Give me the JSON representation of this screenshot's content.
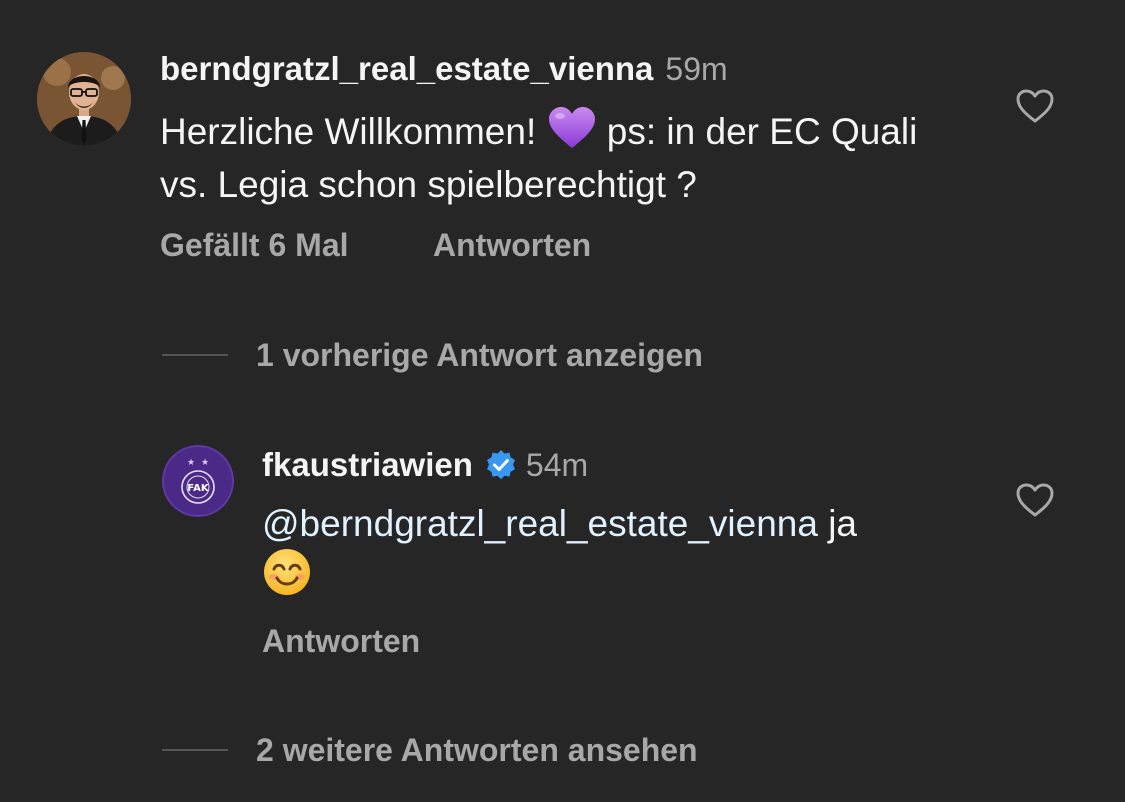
{
  "comment_1": {
    "username": "berndgratzl_real_estate_vienna",
    "time": "59m",
    "text_before_emoji": "Herzliche Willkommen! ",
    "emoji": "purple-heart",
    "text_after_emoji": " ps: in der EC Quali vs. Legia schon spielberechtigt ?",
    "likes_label": "Gefällt 6 Mal",
    "reply_label": "Antworten",
    "avatar": "user-avatar-photo"
  },
  "view_previous_label": "1 vorherige Antwort anzeigen",
  "comment_2": {
    "username": "fkaustriawien",
    "verified": true,
    "time": "54m",
    "mention": "@berndgratzl_real_estate_vienna",
    "text": " ja",
    "emoji": "smiling-face",
    "reply_label": "Antworten",
    "avatar": "fk-austria-wien-crest"
  },
  "view_more_label": "2 weitere Antworten ansehen",
  "colors": {
    "background": "#262626",
    "primary_text": "#f5f5f5",
    "secondary_text": "#a8a8a8",
    "mention": "#e0f1ff",
    "verified_badge": "#3897f0",
    "club_purple": "#4b2a87"
  }
}
